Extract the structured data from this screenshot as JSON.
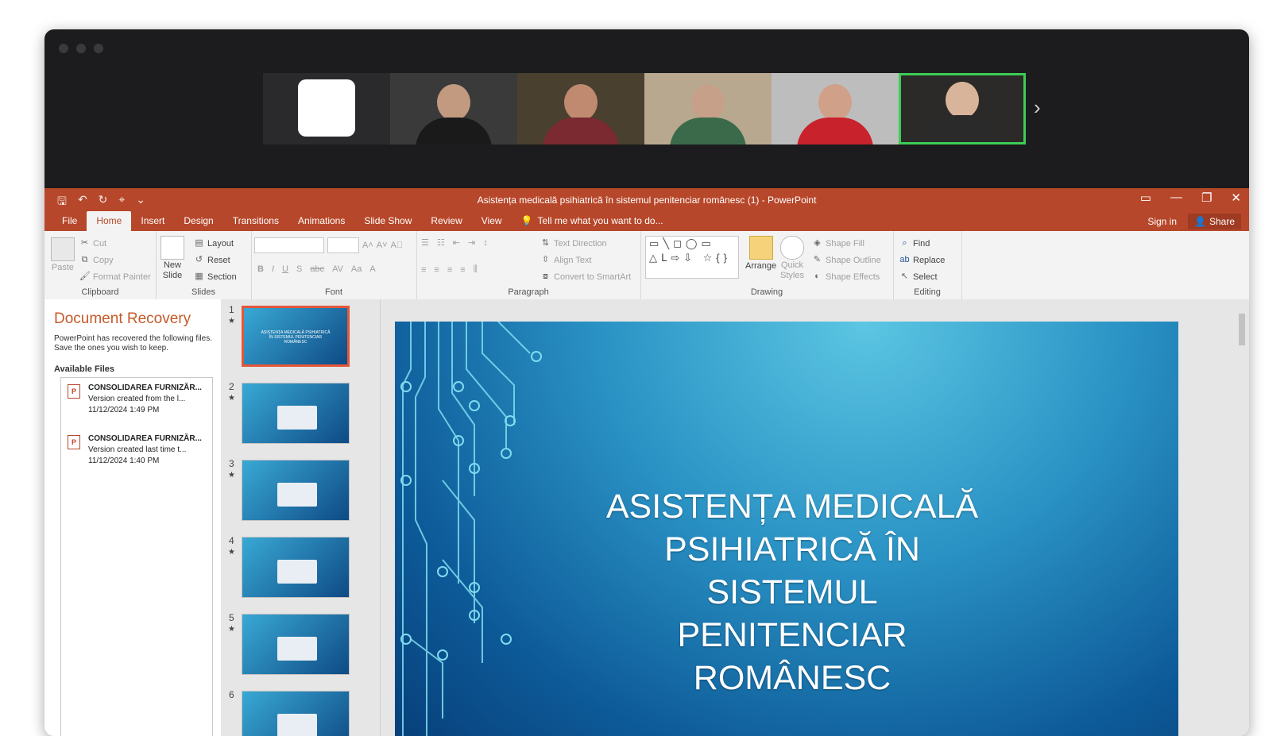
{
  "gallery": {
    "participants": [
      {
        "name": "blank-tile",
        "kind": "blank"
      },
      {
        "name": "participant-1",
        "bg": "#3a3a3a",
        "skin": "#c29a80",
        "shirt": "#1a1a1a"
      },
      {
        "name": "participant-2",
        "bg": "#4a4030",
        "skin": "#c08a70",
        "shirt": "#7a2a30"
      },
      {
        "name": "participant-3",
        "bg": "#b8a890",
        "skin": "#c6a088",
        "shirt": "#3a6a4a"
      },
      {
        "name": "participant-4",
        "bg": "#bdbdbd",
        "skin": "#d0a088",
        "shirt": "#c8222c"
      },
      {
        "name": "participant-5",
        "bg": "#2c2a28",
        "skin": "#d8b49a",
        "shirt": "#2a2a2a",
        "active": true
      }
    ],
    "next_icon": "›"
  },
  "app": {
    "title": "Asistența medicală psihiatrică în sistemul penitenciar românesc (1) - PowerPoint",
    "accent": "#b7472a",
    "window_controls": {
      "ribbon_display": "▭",
      "minimize": "—",
      "restore": "❐",
      "close": "✕"
    }
  },
  "qat": {
    "save": "🖫",
    "undo": "↶",
    "redo": "↻",
    "present": "⌖",
    "customize": "⌄"
  },
  "tabs": [
    {
      "label": "File"
    },
    {
      "label": "Home",
      "active": true
    },
    {
      "label": "Insert"
    },
    {
      "label": "Design"
    },
    {
      "label": "Transitions"
    },
    {
      "label": "Animations"
    },
    {
      "label": "Slide Show"
    },
    {
      "label": "Review"
    },
    {
      "label": "View"
    }
  ],
  "tell_me": "Tell me what you want to do...",
  "tabs_right": {
    "sign_in": "Sign in",
    "share": "Share"
  },
  "ribbon": {
    "clipboard": {
      "label": "Clipboard",
      "paste": "Paste",
      "cut": "Cut",
      "copy": "Copy",
      "format_painter": "Format Painter"
    },
    "slides": {
      "label": "Slides",
      "new_slide_1": "New",
      "new_slide_2": "Slide",
      "layout": "Layout",
      "reset": "Reset",
      "section": "Section"
    },
    "font": {
      "label": "Font",
      "bold": "B",
      "italic": "I",
      "underline": "U",
      "shadow": "S",
      "strike": "abc",
      "spacing": "AV",
      "case": "Aa",
      "color": "A",
      "grow": "A˄",
      "shrink": "A˅",
      "clear": "A⃠"
    },
    "paragraph": {
      "label": "Paragraph",
      "text_direction": "Text Direction",
      "align_text": "Align Text",
      "convert_smartart": "Convert to SmartArt"
    },
    "drawing": {
      "label": "Drawing",
      "arrange": "Arrange",
      "quick_styles_1": "Quick",
      "quick_styles_2": "Styles",
      "shape_fill": "Shape Fill",
      "shape_outline": "Shape Outline",
      "shape_effects": "Shape Effects",
      "shapes_gallery": "▭╲◻◯▭ △ᒪ⇨⇩ ☆{}"
    },
    "editing": {
      "label": "Editing",
      "find": "Find",
      "replace": "Replace",
      "select": "Select"
    }
  },
  "recovery": {
    "title": "Document Recovery",
    "description": "PowerPoint has recovered the following files.  Save the ones you wish to keep.",
    "available_label": "Available Files",
    "files": [
      {
        "name": "CONSOLIDAREA FURNIZĂR...",
        "desc": "Version created from the l...",
        "time": "11/12/2024 1:49 PM"
      },
      {
        "name": "CONSOLIDAREA FURNIZĂR...",
        "desc": "Version created last time t...",
        "time": "11/12/2024 1:40 PM"
      }
    ]
  },
  "thumbnails": [
    {
      "num": "1",
      "star": "★",
      "selected": true,
      "title": "ASISTENȚA MEDICALĂ PSIHIATRICĂ ÎN SISTEMUL PENITENCIAR ROMÂNESC"
    },
    {
      "num": "2",
      "star": "★"
    },
    {
      "num": "3",
      "star": "★"
    },
    {
      "num": "4",
      "star": "★"
    },
    {
      "num": "5",
      "star": "★"
    },
    {
      "num": "6",
      "star": ""
    }
  ],
  "slide": {
    "title_line_1": "ASISTENȚA MEDICALĂ",
    "title_line_2": "PSIHIATRICĂ ÎN SISTEMUL",
    "title_line_3": "PENITENCIAR ROMÂNESC"
  }
}
